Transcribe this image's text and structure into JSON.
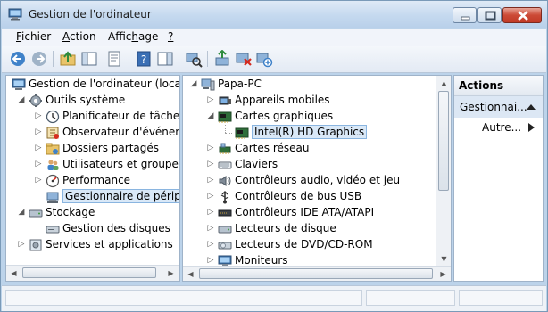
{
  "window": {
    "title": "Gestion de l'ordinateur"
  },
  "menu": {
    "items": [
      "Fichier",
      "Action",
      "Affichage",
      "?"
    ]
  },
  "toolbar": {
    "icons": [
      "back-icon",
      "forward-icon",
      "up-folder-icon",
      "show-hide-tree-icon",
      "properties-icon",
      "help-icon",
      "show-hide-action-pane-icon",
      "scan-hardware-icon",
      "update-driver-icon",
      "disable-device-icon",
      "uninstall-device-icon"
    ]
  },
  "left_tree": {
    "items": [
      {
        "label": "Gestion de l'ordinateur (local)",
        "icon": "computer-management-icon",
        "level": 0,
        "expander": ""
      },
      {
        "label": "Outils système",
        "icon": "system-tools-icon",
        "level": 1,
        "expander": "◢"
      },
      {
        "label": "Planificateur de tâches",
        "icon": "clock-icon",
        "level": 2,
        "expander": "▷"
      },
      {
        "label": "Observateur d'événeme",
        "icon": "event-viewer-icon",
        "level": 2,
        "expander": "▷"
      },
      {
        "label": "Dossiers partagés",
        "icon": "shared-folder-icon",
        "level": 2,
        "expander": "▷"
      },
      {
        "label": "Utilisateurs et groupes l",
        "icon": "users-icon",
        "level": 2,
        "expander": "▷"
      },
      {
        "label": "Performance",
        "icon": "performance-icon",
        "level": 2,
        "expander": "▷"
      },
      {
        "label": "Gestionnaire de périphé",
        "icon": "device-manager-icon",
        "level": 2,
        "expander": "",
        "selected": true
      },
      {
        "label": "Stockage",
        "icon": "storage-icon",
        "level": 1,
        "expander": "◢"
      },
      {
        "label": "Gestion des disques",
        "icon": "disk-management-icon",
        "level": 2,
        "expander": ""
      },
      {
        "label": "Services et applications",
        "icon": "services-icon",
        "level": 1,
        "expander": "▷"
      }
    ]
  },
  "device_tree": {
    "items": [
      {
        "label": "Papa-PC",
        "icon": "pc-icon",
        "level": 0,
        "expander": "◢"
      },
      {
        "label": "Appareils mobiles",
        "icon": "mobile-device-icon",
        "level": 1,
        "expander": "▷"
      },
      {
        "label": "Cartes graphiques",
        "icon": "display-adapter-icon",
        "level": 1,
        "expander": "◢"
      },
      {
        "label": "Intel(R) HD Graphics",
        "icon": "display-adapter-icon",
        "level": 2,
        "expander": "",
        "selected": true
      },
      {
        "label": "Cartes réseau",
        "icon": "network-adapter-icon",
        "level": 1,
        "expander": "▷"
      },
      {
        "label": "Claviers",
        "icon": "keyboard-icon",
        "level": 1,
        "expander": "▷"
      },
      {
        "label": "Contrôleurs audio, vidéo et jeu",
        "icon": "audio-icon",
        "level": 1,
        "expander": "▷"
      },
      {
        "label": "Contrôleurs de bus USB",
        "icon": "usb-icon",
        "level": 1,
        "expander": "▷"
      },
      {
        "label": "Contrôleurs IDE ATA/ATAPI",
        "icon": "ide-controller-icon",
        "level": 1,
        "expander": "▷"
      },
      {
        "label": "Lecteurs de disque",
        "icon": "disk-drive-icon",
        "level": 1,
        "expander": "▷"
      },
      {
        "label": "Lecteurs de DVD/CD-ROM",
        "icon": "dvd-drive-icon",
        "level": 1,
        "expander": "▷"
      },
      {
        "label": "Moniteurs",
        "icon": "monitor-icon",
        "level": 1,
        "expander": "▷"
      }
    ]
  },
  "actions": {
    "header": "Actions",
    "section": "Gestionnai...",
    "more": "Autre..."
  }
}
